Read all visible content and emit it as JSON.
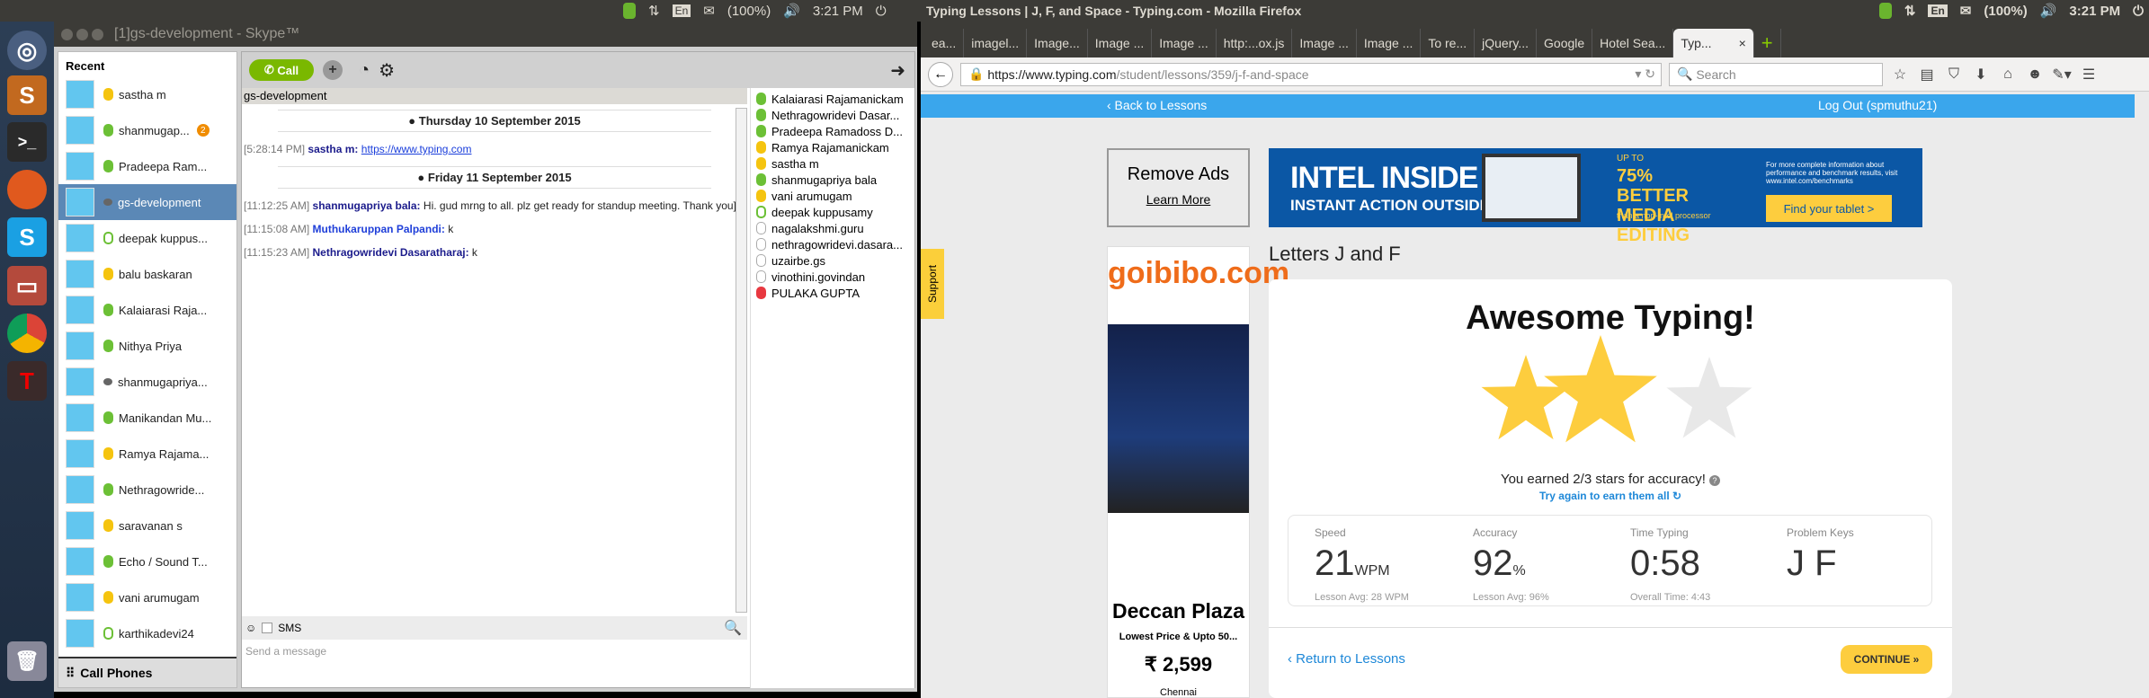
{
  "system": {
    "indicators": [
      "En",
      "(100%)",
      "3:21 PM"
    ]
  },
  "launcher": {
    "items": [
      "ubuntu-dash",
      "sublime-text",
      "terminal",
      "firefox",
      "skype",
      "files",
      "chrome",
      "typing-app",
      "trash"
    ]
  },
  "skype": {
    "title": "[1]gs-development - Skype™",
    "recent_header": "Recent",
    "recent": [
      {
        "name": "sastha m",
        "status": "away"
      },
      {
        "name": "shanmugap...",
        "status": "online",
        "badge": "2"
      },
      {
        "name": "Pradeepa Ram...",
        "status": "online"
      },
      {
        "name": "gs-development",
        "status": "group",
        "selected": true
      },
      {
        "name": "deepak kuppus...",
        "status": "offline"
      },
      {
        "name": "balu baskaran",
        "status": "away"
      },
      {
        "name": "Kalaiarasi Raja...",
        "status": "online"
      },
      {
        "name": "Nithya Priya",
        "status": "online"
      },
      {
        "name": "shanmugapriya...",
        "status": "group"
      },
      {
        "name": "Manikandan Mu...",
        "status": "online"
      },
      {
        "name": "Ramya Rajama...",
        "status": "away"
      },
      {
        "name": "Nethragowride...",
        "status": "online"
      },
      {
        "name": "saravanan s",
        "status": "away"
      },
      {
        "name": "Echo / Sound T...",
        "status": "online"
      },
      {
        "name": "vani arumugam",
        "status": "away"
      },
      {
        "name": "karthikadevi24",
        "status": "offline"
      }
    ],
    "call_phones": "Call Phones",
    "call_label": "Call",
    "chat_name": "gs-development",
    "date1": "Thursday 10 September 2015",
    "msg1": {
      "time": "[5:28:14 PM]",
      "sender": "sastha m:",
      "link": "https://www.typing.com"
    },
    "date2": "Friday 11 September 2015",
    "msg2": {
      "time": "[11:12:25 AM]",
      "sender": "shanmugapriya bala:",
      "text": "Hi. gud mrng to all. plz get ready for standup meeting. Thank you]"
    },
    "msg3": {
      "time": "[11:15:08 AM]",
      "sender": "Muthukaruppan Palpandi:",
      "text": "k"
    },
    "msg4": {
      "time": "[11:15:23 AM]",
      "sender": "Nethragowridevi Dasaratharaj:",
      "text": "k"
    },
    "sms_label": "SMS",
    "input_placeholder": "Send a message",
    "participants": [
      {
        "name": "Kalaiarasi Rajamanickam",
        "status": "online"
      },
      {
        "name": "Nethragowridevi Dasar...",
        "status": "online"
      },
      {
        "name": "Pradeepa Ramadoss  D...",
        "status": "online"
      },
      {
        "name": "Ramya Rajamanickam",
        "status": "away"
      },
      {
        "name": "sastha m",
        "status": "away"
      },
      {
        "name": "shanmugapriya bala",
        "status": "online"
      },
      {
        "name": "vani arumugam",
        "status": "away"
      },
      {
        "name": "deepak kuppusamy",
        "status": "offline"
      },
      {
        "name": "nagalakshmi.guru",
        "status": "unknown"
      },
      {
        "name": "nethragowridevi.dasara...",
        "status": "unknown"
      },
      {
        "name": "uzairbe.gs",
        "status": "unknown"
      },
      {
        "name": "vinothini.govindan",
        "status": "unknown"
      },
      {
        "name": "PULAKA GUPTA",
        "status": "dnd"
      }
    ]
  },
  "firefox": {
    "title": "Typing Lessons | J, F, and Space - Typing.com - Mozilla Firefox",
    "tabs": [
      "ea...",
      "imagel...",
      "Image...",
      "Image ...",
      "Image ...",
      "http:...ox.js",
      "Image ...",
      "Image ...",
      "To re...",
      "jQuery...",
      "Google",
      "Hotel Sea...",
      "Typ..."
    ],
    "url_host": "https://www.typing.com",
    "url_path": "/student/lessons/359/j-f-and-space",
    "search_placeholder": "Search",
    "back_to_lessons": "‹ Back to Lessons",
    "logout": "Log Out (spmuthu21)",
    "support": "Support",
    "remove_ads": "Remove Ads",
    "learn_more": "Learn More",
    "intel": {
      "h1": "INTEL INSIDE",
      "h2": "INSTANT ACTION OUTSIDE",
      "up_to": "UP TO",
      "big": "75% BETTER MEDIA EDITING",
      "small": "than a non-Intel processor",
      "info": "For more complete information about performance and benchmark results, visit www.intel.com/benchmarks",
      "cta": "Find your tablet >"
    },
    "goibibo": {
      "logo": "goibibo.com",
      "hotel": "Deccan Plaza",
      "offer": "Lowest Price & Upto 50...",
      "price": "₹ 2,599",
      "city": "Chennai"
    },
    "lesson_title": "Letters J and F",
    "result_title": "Awesome Typing!",
    "stars_earned": 2,
    "stars_total": 3,
    "earned_text": "You earned 2/3 stars for accuracy!",
    "try_again": "Try again to earn them all ↻",
    "stats": [
      {
        "label": "Speed",
        "value": "21",
        "unit": "WPM",
        "sub": "Lesson Avg: 28 WPM"
      },
      {
        "label": "Accuracy",
        "value": "92",
        "unit": "%",
        "sub": "Lesson Avg: 96%"
      },
      {
        "label": "Time Typing",
        "value": "0:58",
        "unit": "",
        "sub": "Overall Time: 4:43"
      },
      {
        "label": "Problem Keys",
        "value": "J F",
        "unit": "",
        "sub": ""
      }
    ],
    "return": "‹ Return to Lessons",
    "continue": "CONTINUE »",
    "colors": {
      "accent": "#3aa6ec",
      "star": "#fdcd3e",
      "continue": "#fdcd3e"
    }
  }
}
